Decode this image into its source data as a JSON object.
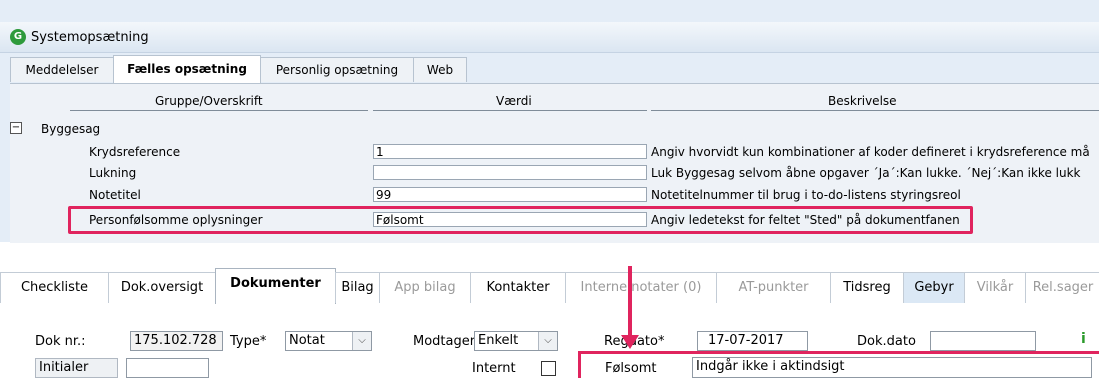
{
  "window": {
    "title": "Systemopsætning"
  },
  "top_tabs": [
    "Meddelelser",
    "Fælles opsætning",
    "Personlig opsætning",
    "Web"
  ],
  "top_active_tab": "Fælles opsætning",
  "grid": {
    "headers": {
      "group": "Gruppe/Overskrift",
      "value": "Værdi",
      "description": "Beskrivelse"
    },
    "group_name": "Byggesag",
    "rows": [
      {
        "label": "Krydsreference",
        "value": "1",
        "description": "Angiv hvorvidt kun kombinationer af koder defineret i krydsreference må"
      },
      {
        "label": "Lukning",
        "value": "",
        "description": "Luk Byggesag selvom åbne opgaver ´Ja´:Kan lukke. ´Nej´:Kan ikke lukk"
      },
      {
        "label": "Notetitel",
        "value": "99",
        "description": "Notetitelnummer til brug i to-do-listens styringsreol"
      },
      {
        "label": "Personfølsomme oplysninger",
        "value": "Følsomt",
        "description": "Angiv ledetekst for feltet \"Sted\" på dokumentfanen"
      }
    ]
  },
  "bottom_tabs": [
    {
      "label": "Checkliste",
      "state": "normal"
    },
    {
      "label": "Dok.oversigt",
      "state": "normal"
    },
    {
      "label": "Dokumenter",
      "state": "active"
    },
    {
      "label": "Bilag",
      "state": "normal"
    },
    {
      "label": "App bilag",
      "state": "dim"
    },
    {
      "label": "Kontakter",
      "state": "normal"
    },
    {
      "label": "Interne notater (0)",
      "state": "dim"
    },
    {
      "label": "AT-punkter",
      "state": "dim"
    },
    {
      "label": "Tidsreg",
      "state": "normal"
    },
    {
      "label": "Gebyr",
      "state": "blue"
    },
    {
      "label": "Vilkår",
      "state": "dim"
    },
    {
      "label": "Rel.sager",
      "state": "dim"
    }
  ],
  "form": {
    "dok_nr_label": "Dok nr.:",
    "dok_nr_value": "175.102.728",
    "type_label": "Type*",
    "type_value": "Notat",
    "modtager_label": "Modtager",
    "modtager_value": "Enkelt",
    "regdato_label": "Regdato*",
    "regdato_value": "17-07-2017",
    "dokdato_label": "Dok.dato",
    "dokdato_value": "",
    "info_icon": "i",
    "initialer_label": "Initialer",
    "initialer_value": "",
    "internt_label": "Internt",
    "folsomt_label": "Følsomt",
    "folsomt_value": "Indgår ikke i aktindsigt"
  },
  "colors": {
    "highlight": "#e0245e",
    "panel": "#e4edf7"
  }
}
